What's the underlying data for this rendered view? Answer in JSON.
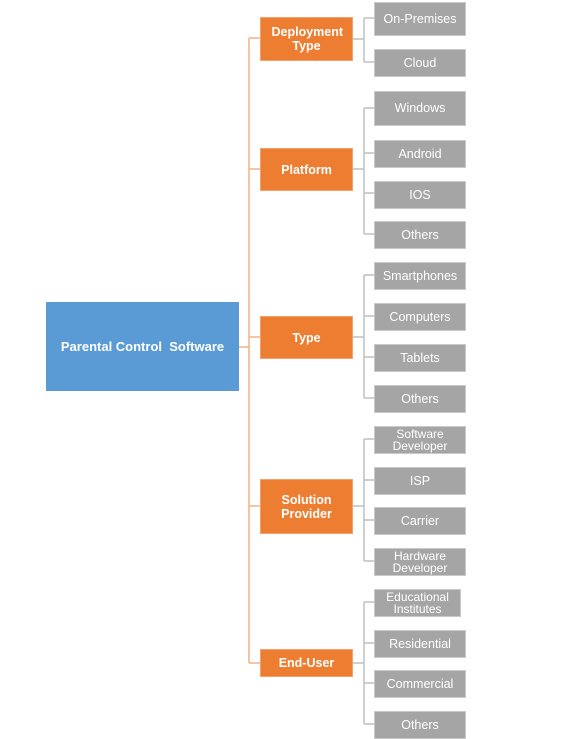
{
  "colors": {
    "root": "#5b9bd5",
    "category": "#ed7d31",
    "leaf": "#a5a5a5",
    "spine": "#f4b183",
    "connector": "#bfbfbf"
  },
  "root": {
    "label": "Parental Control  Software"
  },
  "categories": [
    {
      "label": "Deployment Type",
      "children": [
        "On-Premises",
        "Cloud"
      ]
    },
    {
      "label": "Platform",
      "children": [
        "Windows",
        "Android",
        "IOS",
        "Others"
      ]
    },
    {
      "label": "Type",
      "children": [
        "Smartphones",
        "Computers",
        "Tablets",
        "Others"
      ]
    },
    {
      "label": "Solution Provider",
      "children": [
        "Software Developer",
        "ISP",
        "Carrier",
        "Hardware Developer"
      ]
    },
    {
      "label": "End-User",
      "children": [
        "Educational Institutes",
        "Residential",
        "Commercial",
        "Others"
      ]
    }
  ]
}
